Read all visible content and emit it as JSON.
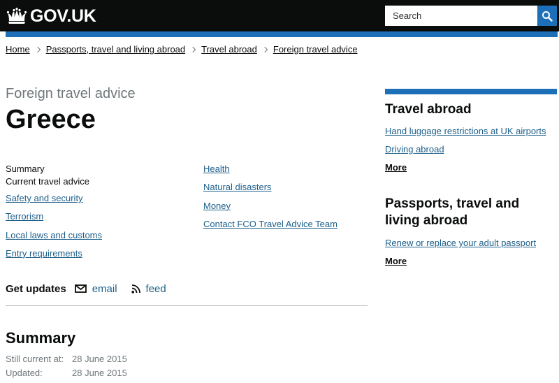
{
  "header": {
    "logo_text": "GOV.UK",
    "crown_icon": "crown-icon",
    "search_placeholder": "Search",
    "search_icon": "search-icon"
  },
  "breadcrumbs": [
    {
      "label": "Home"
    },
    {
      "label": "Passports, travel and living abroad"
    },
    {
      "label": "Travel abroad"
    },
    {
      "label": "Foreign travel advice"
    }
  ],
  "page": {
    "caption": "Foreign travel advice",
    "title": "Greece"
  },
  "contents": {
    "left": [
      {
        "label": "Summary",
        "link": false
      },
      {
        "label": "Current travel advice",
        "link": false
      },
      {
        "label": "Safety and security",
        "link": true
      },
      {
        "label": "Terrorism",
        "link": true
      },
      {
        "label": "Local laws and customs",
        "link": true
      },
      {
        "label": "Entry requirements",
        "link": true
      }
    ],
    "right": [
      {
        "label": "Health",
        "link": true
      },
      {
        "label": "Natural disasters",
        "link": true
      },
      {
        "label": "Money",
        "link": true
      },
      {
        "label": "Contact FCO Travel Advice Team",
        "link": true
      }
    ]
  },
  "updates": {
    "label": "Get updates",
    "email_label": "email",
    "email_icon": "envelope-icon",
    "feed_label": "feed",
    "feed_icon": "rss-icon"
  },
  "summary": {
    "heading": "Summary",
    "still_current_label": "Still current at:",
    "still_current_value": "28 June 2015",
    "updated_label": "Updated:",
    "updated_value": "28 June 2015"
  },
  "sidebar": {
    "sections": [
      {
        "heading": "Travel abroad",
        "links": [
          "Hand luggage restrictions at UK airports",
          "Driving abroad"
        ],
        "more": "More"
      },
      {
        "heading": "Passports, travel and living abroad",
        "links": [
          "Renew or replace your adult passport"
        ],
        "more": "More"
      }
    ]
  },
  "colors": {
    "header_bg": "#0b0c0c",
    "brand_blue": "#1d70b8",
    "link": "#1d5f8a",
    "secondary_text": "#6f777b"
  }
}
